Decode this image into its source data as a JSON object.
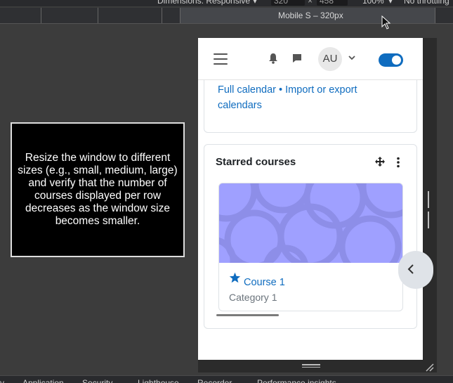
{
  "devtools": {
    "dimensions_label": "Dimensions: Responsive",
    "width_value": "320",
    "height_value": "458",
    "zoom": "100%",
    "throttling": "No throttling",
    "media_label": "Mobile S – 320px",
    "bottom_tabs": [
      "y",
      "Application",
      "Security",
      "Lighthouse",
      "Recorder",
      "Performance insights"
    ]
  },
  "navbar": {
    "avatar_initials": "AU"
  },
  "calendar": {
    "links": "Full calendar • Import or export calendars"
  },
  "starred": {
    "title": "Starred courses",
    "course_name": "Course 1",
    "course_category": "Category 1"
  },
  "overlay": {
    "text": "Resize the window to different sizes (e.g., small, medium, large) and verify that the number of courses displayed per row decreases as the window size becomes smaller."
  },
  "colors": {
    "accent": "#0f6cbf",
    "course_image": "#9fa0ff"
  }
}
